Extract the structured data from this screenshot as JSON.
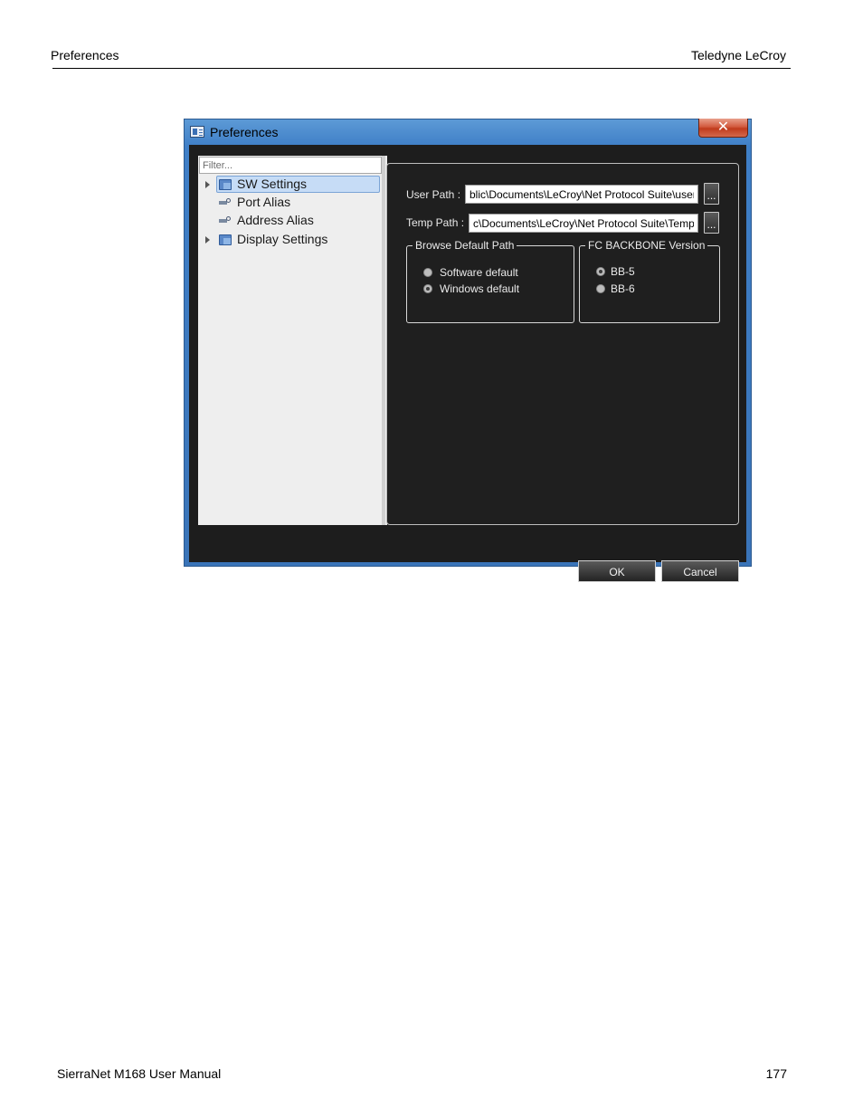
{
  "document": {
    "header_left": "Preferences",
    "header_right": "Teledyne LeCroy",
    "footer_left": "SierraNet M168 User Manual",
    "footer_right": "177"
  },
  "dialog": {
    "title": "Preferences",
    "close_glyph": "✕",
    "filter_placeholder": "Filter...",
    "tree": {
      "items": [
        {
          "label": "SW Settings",
          "icon": "folder-icon",
          "expandable": true,
          "selected": true
        },
        {
          "label": "Port Alias",
          "icon": "alias-icon",
          "expandable": false,
          "selected": false
        },
        {
          "label": "Address Alias",
          "icon": "alias-icon",
          "expandable": false,
          "selected": false
        },
        {
          "label": "Display Settings",
          "icon": "folder-icon",
          "expandable": true,
          "selected": false
        }
      ]
    },
    "user_path": {
      "label": "User Path :",
      "value": "blic\\Documents\\LeCroy\\Net Protocol Suite\\user\\",
      "button": "..."
    },
    "temp_path": {
      "label": "Temp Path :",
      "value": "c\\Documents\\LeCroy\\Net Protocol Suite\\Temp\\",
      "button": "..."
    },
    "browse_group": {
      "title": "Browse Default Path",
      "options": [
        {
          "label": "Software default",
          "checked": false
        },
        {
          "label": "Windows default",
          "checked": true
        }
      ]
    },
    "backbone_group": {
      "title": "FC BACKBONE Version",
      "options": [
        {
          "label": "BB-5",
          "checked": true
        },
        {
          "label": "BB-6",
          "checked": false
        }
      ]
    },
    "ok_label": "OK",
    "cancel_label": "Cancel"
  }
}
